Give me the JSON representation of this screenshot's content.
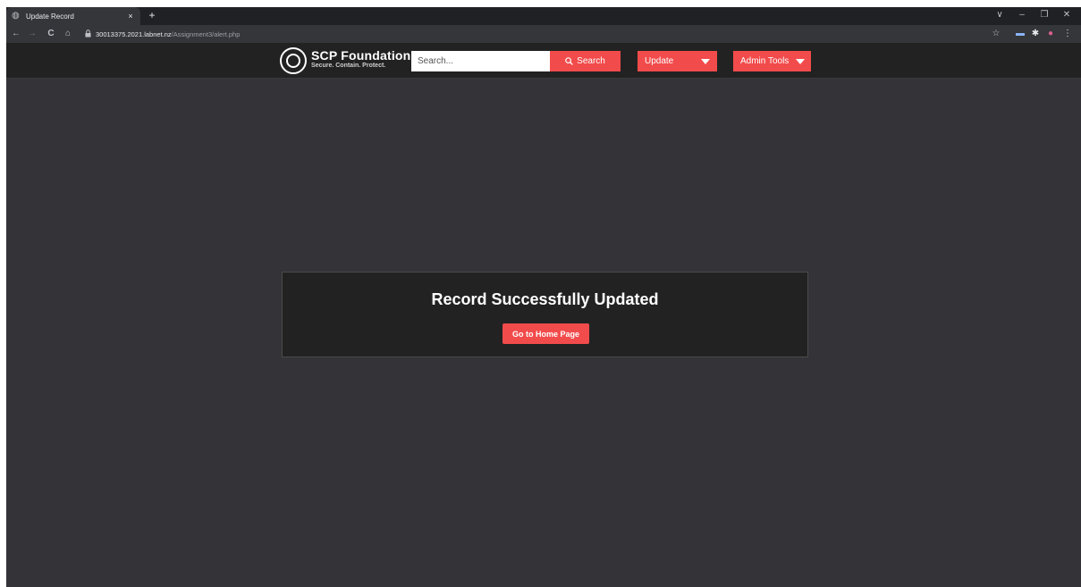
{
  "browser": {
    "tab_title": "Update Record",
    "tab_close_glyph": "×",
    "new_tab_glyph": "+",
    "favicon_icon": "globe-icon",
    "window_controls": {
      "collapse": "∨",
      "minimize": "–",
      "restore": "❐",
      "close": "✕"
    },
    "nav": {
      "back": "←",
      "forward": "→",
      "reload": "C",
      "home": "⌂"
    },
    "url_host": "30013375.2021.labnet.nz",
    "url_path": "/Assignment3/alert.php",
    "toolbar_icons": [
      "star-icon",
      "media-icon",
      "extensions-icon",
      "profile-icon",
      "menu-icon"
    ]
  },
  "site": {
    "brand_title": "SCP Foundation",
    "brand_tagline": "Secure. Contain. Protect.",
    "search_placeholder": "Search...",
    "search_button": "Search",
    "update_menu": "Update",
    "admin_menu": "Admin Tools"
  },
  "alert": {
    "title": "Record Successfully Updated",
    "button": "Go to Home Page"
  },
  "colors": {
    "accent": "#f24b4b",
    "header_bg": "#222222",
    "page_bg": "#333338",
    "alert_bg": "#222222"
  }
}
